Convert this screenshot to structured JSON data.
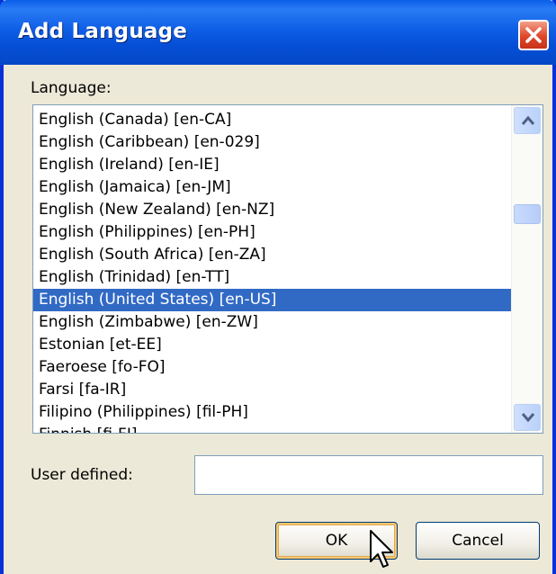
{
  "window": {
    "title": "Add Language"
  },
  "language_label": "Language:",
  "languages": [
    "English (Canada) [en-CA]",
    "English (Caribbean) [en-029]",
    "English (Ireland) [en-IE]",
    "English (Jamaica) [en-JM]",
    "English (New Zealand) [en-NZ]",
    "English (Philippines) [en-PH]",
    "English (South Africa) [en-ZA]",
    "English (Trinidad) [en-TT]",
    "English (United States) [en-US]",
    "English (Zimbabwe) [en-ZW]",
    "Estonian [et-EE]",
    "Faeroese [fo-FO]",
    "Farsi [fa-IR]",
    "Filipino (Philippines) [fil-PH]",
    "Finnish [fi-FI]"
  ],
  "selected_language": "English (United States) [en-US]",
  "user_defined": {
    "label": "User defined:",
    "value": ""
  },
  "buttons": {
    "ok": "OK",
    "cancel": "Cancel"
  },
  "colors": {
    "title_bar": "#0a5ee8",
    "selection": "#316ac5",
    "close_button": "#e0462a",
    "dialog_bg": "#ece9d8"
  },
  "icons": {
    "close": "close-icon",
    "scroll_up": "scroll-up-arrow-icon",
    "scroll_down": "scroll-down-arrow-icon",
    "cursor": "mouse-pointer-icon"
  }
}
